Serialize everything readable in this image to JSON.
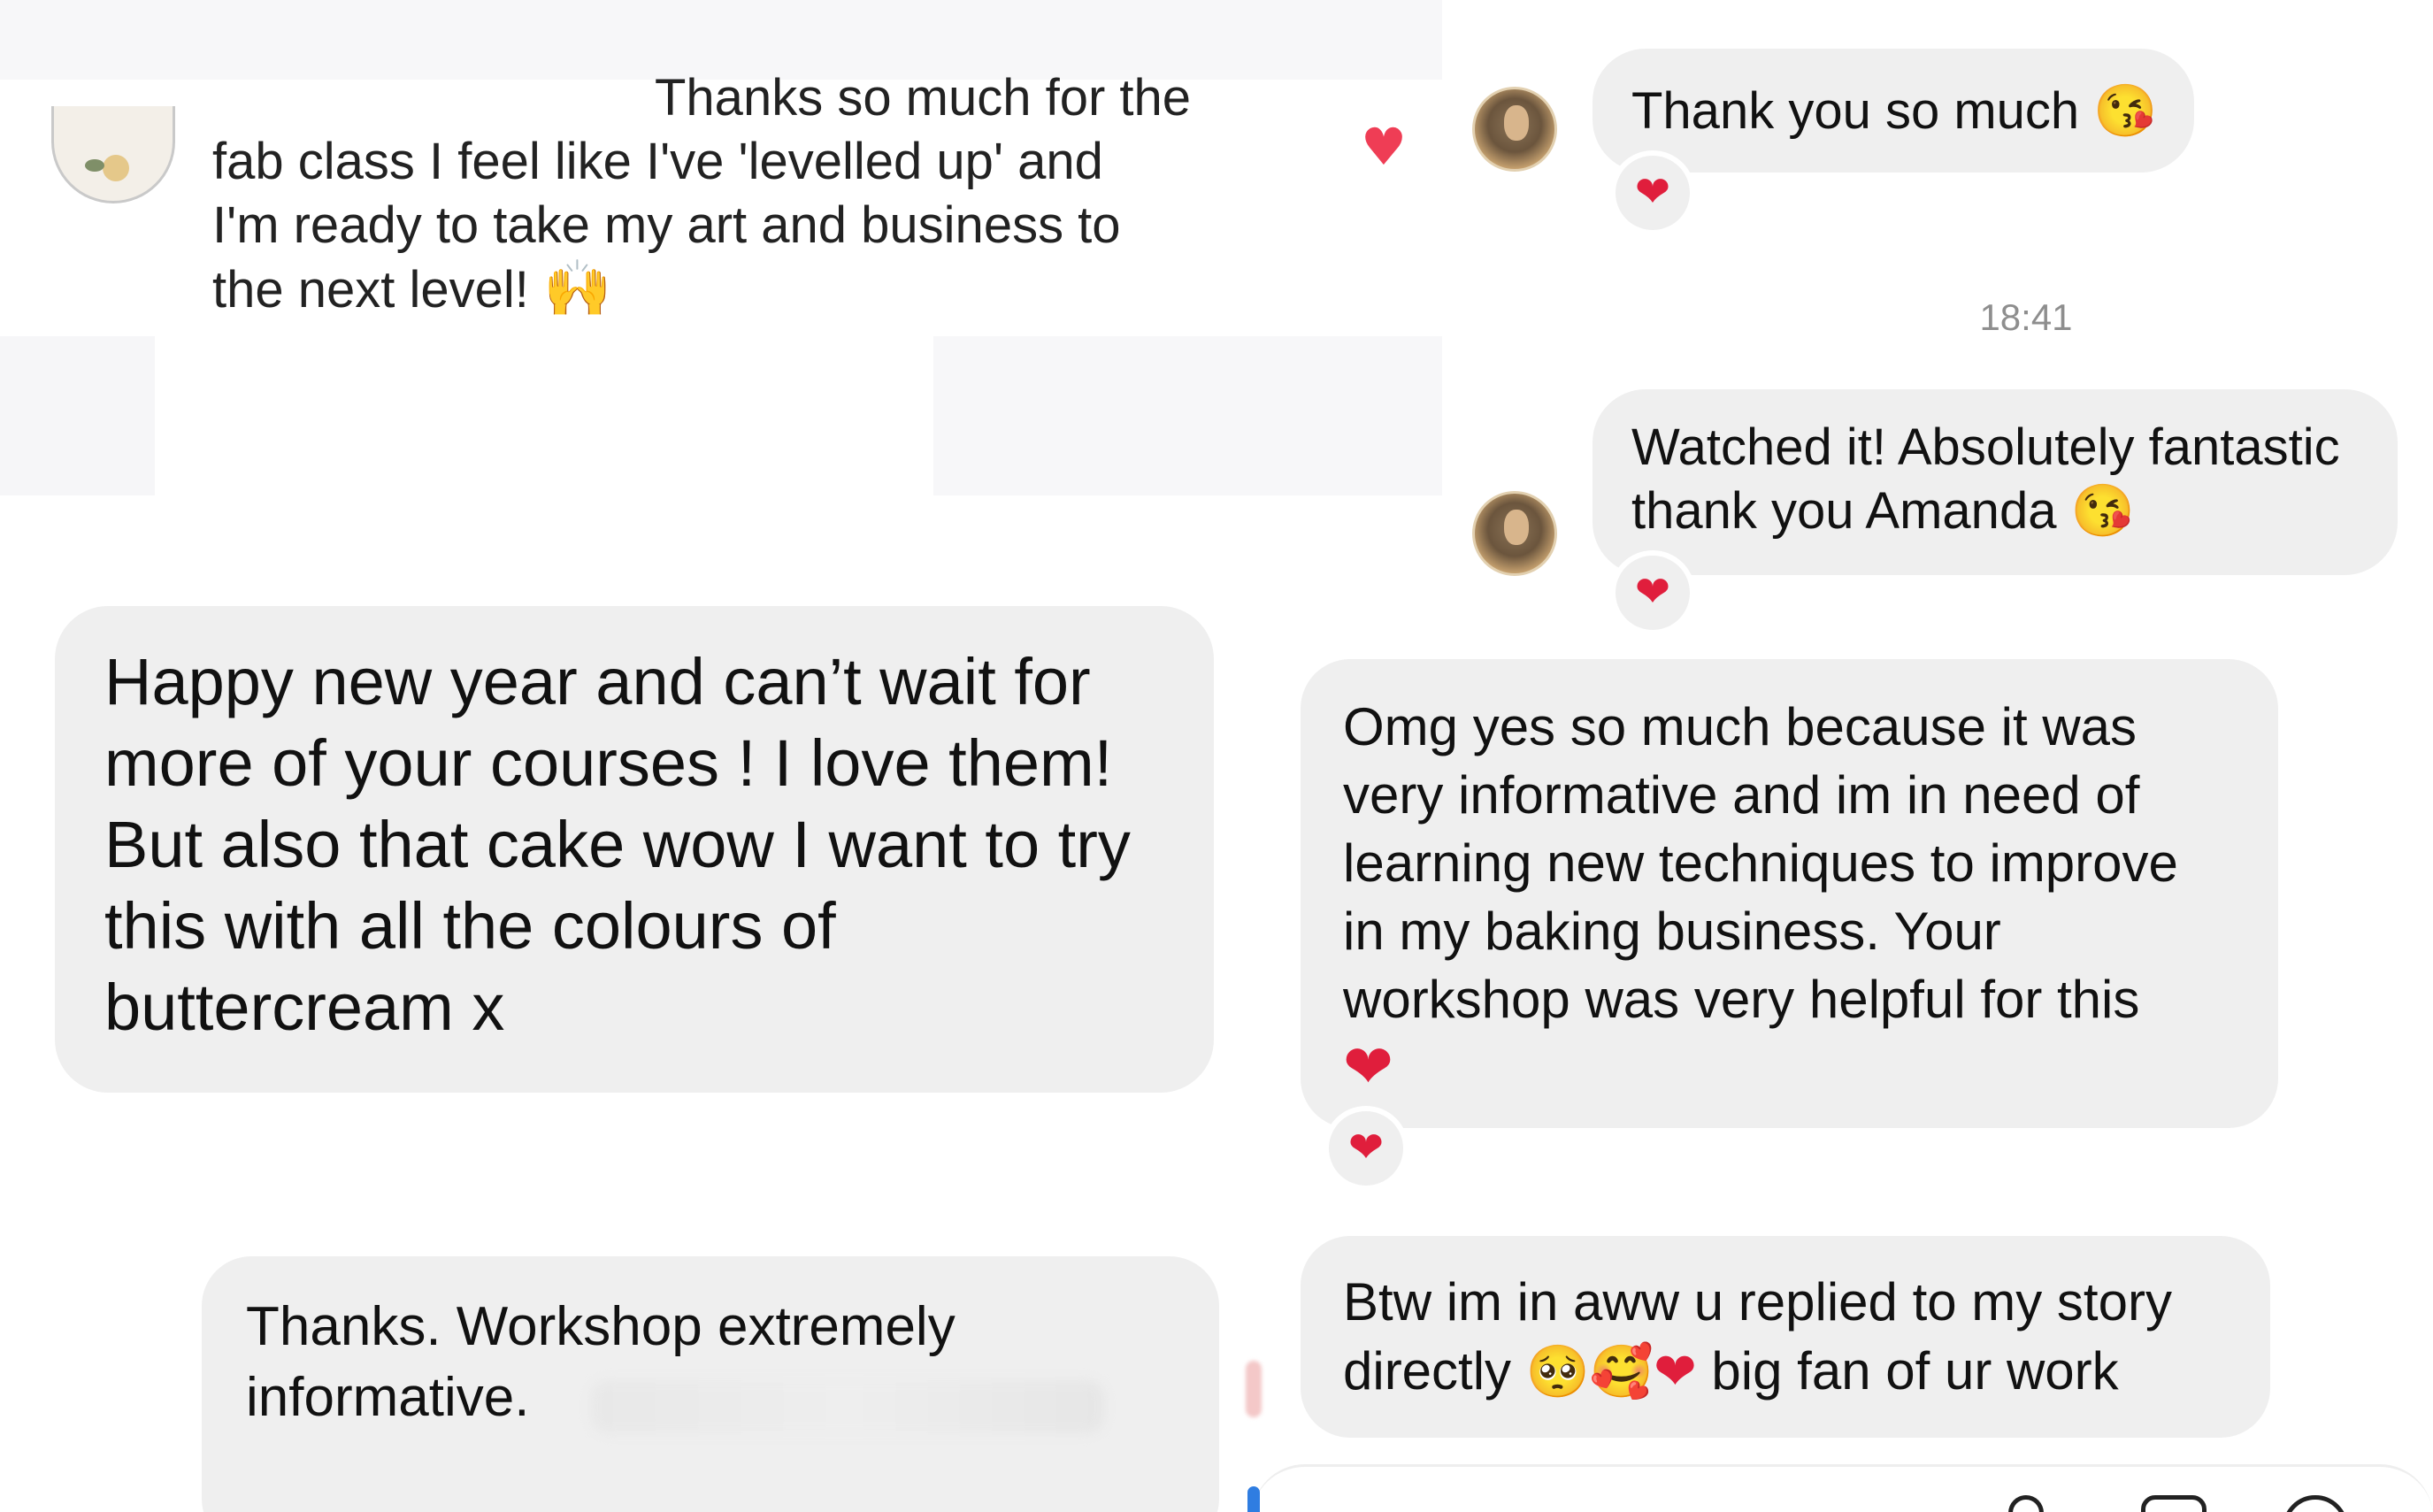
{
  "top_left": {
    "message_lines": [
      "Thanks so much for the",
      "fab class I feel like I've 'levelled up' and",
      "I'm ready to take my art and business to",
      "the next level! "
    ],
    "message_emoji": "🙌"
  },
  "top_right": {
    "like_heart": "♥",
    "messages": [
      {
        "text": "Thank you so much 😘",
        "reaction": "❤"
      },
      {
        "text": "Watched it! Absolutely fantastic\nthank you Amanda 😘",
        "reaction": "❤"
      }
    ],
    "timestamp": "18:41"
  },
  "middle_left": {
    "message": "Happy new year and can’t wait for\nmore of your courses ! I love them!\nBut also that cake wow I want to try\nthis with all the colours of\nbuttercream x"
  },
  "middle_right": {
    "message": "Omg yes so much because it was\nvery informative and im in need of\nlearning new techniques to improve\nin my baking business. Your\nworkshop was very helpful for this\n",
    "message_emoji": "❤",
    "reaction": "❤"
  },
  "bottom_left": {
    "message": "Thanks. Workshop extremely\ninformative."
  },
  "bottom_right": {
    "message_start": "Btw im in aww u replied to my story\ndirectly ",
    "emojis": "🥺🥰",
    "heart": "❤",
    "message_end": " big fan of ur work"
  },
  "colors": {
    "bubble": "#efefef",
    "heart": "#e01e3c",
    "timestamp": "#8e8e8e"
  },
  "icons": [
    "like-heart-icon",
    "avatar",
    "mic-icon",
    "photo-icon",
    "sticker-icon"
  ]
}
